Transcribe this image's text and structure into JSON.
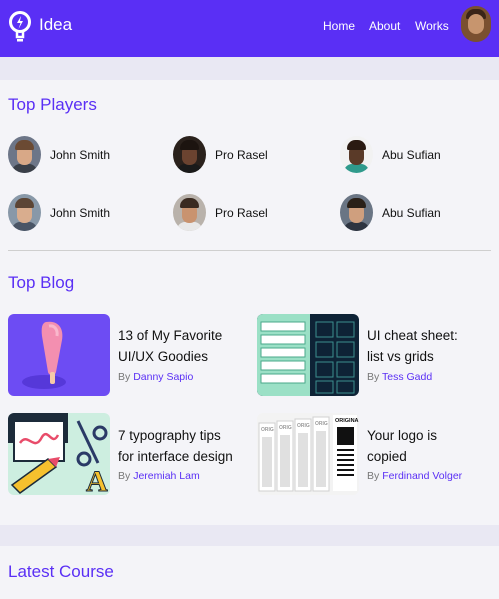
{
  "header": {
    "brand": "Idea",
    "nav": [
      "Home",
      "About",
      "Works"
    ],
    "bar_color": "#5a2ff5"
  },
  "sections": {
    "players_title": "Top Players",
    "blog_title": "Top Blog",
    "course_title": "Latest Course"
  },
  "players": [
    {
      "name": "John Smith"
    },
    {
      "name": "Pro Rasel"
    },
    {
      "name": "Abu Sufian"
    },
    {
      "name": "John Smith"
    },
    {
      "name": "Pro Rasel"
    },
    {
      "name": "Abu Sufian"
    }
  ],
  "blogs": [
    {
      "title_line1": "13 of My Favorite",
      "title_line2": "UI/UX Goodies",
      "by": "By",
      "author": "Danny Sapio",
      "image": "popsicle-illustration"
    },
    {
      "title_line1": "UI cheat sheet:",
      "title_line2": "list vs grids",
      "by": "By",
      "author": "Tess Gadd",
      "image": "list-vs-grid-illustration"
    },
    {
      "title_line1": "7 typography tips",
      "title_line2": "for interface design",
      "by": "By",
      "author": "Jeremiah Lam",
      "image": "typography-illustration"
    },
    {
      "title_line1": "Your logo is",
      "title_line2": "copied",
      "by": "By",
      "author": "Ferdinand Volger",
      "image": "copied-logo-illustration"
    }
  ],
  "blog_image_texts": {
    "typography_letter": "A",
    "logo_word": "ORIGINA",
    "logo_copy_word": "ORIG"
  }
}
